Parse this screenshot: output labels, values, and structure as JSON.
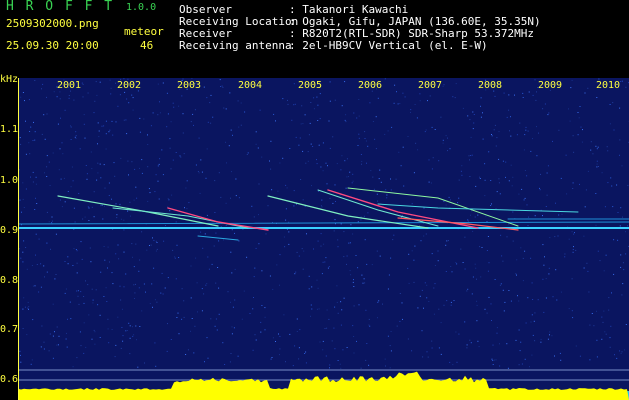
{
  "header": {
    "brand": "H R O F F T",
    "version": "1.0.0",
    "filename": "2509302000.png",
    "datetime": "25.09.30 20:00",
    "meteor_label": "meteor",
    "meteor_count": "46",
    "info": [
      {
        "label": "Observer",
        "value": ": Takanori Kawachi"
      },
      {
        "label": "Receiving Location",
        "value": ": Ogaki, Gifu, JAPAN (136.60E, 35.35N)"
      },
      {
        "label": "Receiver",
        "value": ": R820T2(RTL-SDR) SDR-Sharp 53.372MHz"
      },
      {
        "label": "Receiving antenna",
        "value": ": 2el-HB9CV Vertical (el. E-W)"
      }
    ]
  },
  "axes": {
    "y_unit": "kHz",
    "y_ticks": [
      "1.1",
      "1.0",
      "0.9",
      "0.8",
      "0.7",
      "0.6"
    ],
    "x_ticks": [
      "2001",
      "2002",
      "2003",
      "2004",
      "2005",
      "2006",
      "2007",
      "2008",
      "2009",
      "2010"
    ]
  },
  "colors": {
    "background": "#000000",
    "spectrogram": "#0a1560",
    "label_text": "#ffff40",
    "brand_text": "#39d353",
    "info_text": "#ffffff",
    "baseline": "#22c3e8",
    "level_fill": "#ffff00"
  }
}
